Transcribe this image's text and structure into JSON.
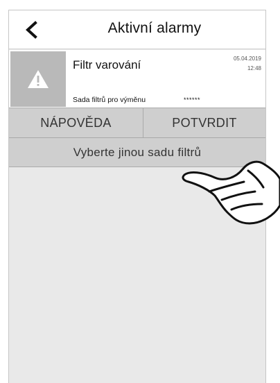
{
  "header": {
    "back_icon": "chevron-left-icon",
    "title": "Aktivní alarmy"
  },
  "alarm": {
    "icon": "warning-triangle-icon",
    "name": "Filtr varování",
    "date": "05.04.2019",
    "time": "12:48",
    "detail": "Sada filtrů pro výměnu",
    "code": "******"
  },
  "actions": {
    "help_label": "NÁPOVĚDA",
    "confirm_label": "POTVRDIT",
    "select_filter_label": "Vyberte jinou sadu filtrů"
  },
  "overlay": {
    "icon": "pointing-hand-icon"
  },
  "colors": {
    "background": "#e9e9e9",
    "button": "#cfcfcf",
    "icon_box": "#b9b9b9"
  }
}
